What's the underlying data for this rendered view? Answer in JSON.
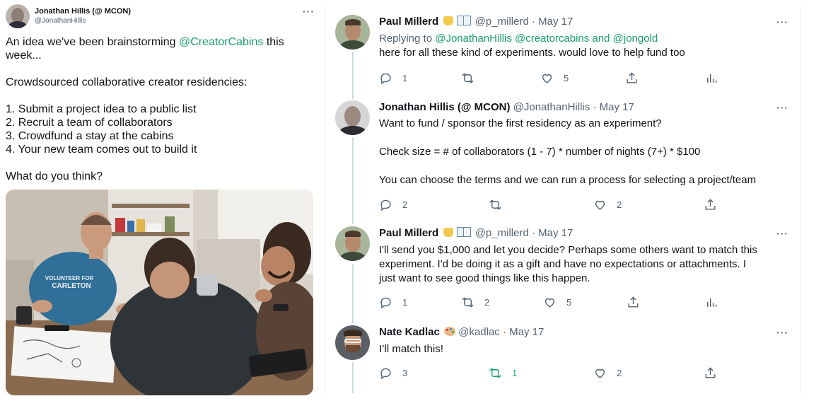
{
  "left_tweet": {
    "author_name": "Jonathan Hillis (@ MCON)",
    "author_handle": "@JonathanHillis",
    "more": "···",
    "text_line1_before": "An idea we've been brainstorming ",
    "text_line1_mention": "@CreatorCabins",
    "text_line1_after": " this",
    "text_line2": "week...",
    "text_line3": "Crowdsourced collaborative creator residencies:",
    "steps": [
      "1. Submit a project idea to a public list",
      "2. Recruit a team of collaborators",
      "3. Crowdfund a stay at the cabins",
      "4. Your new team comes out to build it"
    ],
    "closing": "What do you think?",
    "shirt_text_1": "VOLUNTEER FOR",
    "shirt_text_2": "CARLETON"
  },
  "replies": [
    {
      "name": "Paul Millerd",
      "handle": "@p_millerd",
      "date": "May 17",
      "replying_prefix": "Replying to ",
      "replying_mentions": "@JonathanHillis @creatorcabins and @jongold",
      "body": [
        "here for all these kind of experiments.  would love to help fund too"
      ],
      "reply_count": "1",
      "retweet_count": "",
      "like_count": "5",
      "more": "···"
    },
    {
      "name": "Jonathan Hillis (@ MCON)",
      "handle": "@JonathanHillis",
      "date": "May 17",
      "body": [
        "Want to fund / sponsor the first residency as an experiment?",
        "Check size = # of collaborators (1 - 7) * number of nights (7+) * $100",
        "You can choose the terms and we can run a process for selecting a project/team"
      ],
      "reply_count": "2",
      "retweet_count": "",
      "like_count": "2",
      "more": "···"
    },
    {
      "name": "Paul Millerd",
      "handle": "@p_millerd",
      "date": "May 17",
      "body": [
        "I'll send you $1,000 and let you decide?  Perhaps some others want to match this",
        "experiment.  I'd be doing it as a gift and have no expectations or attachments.  I",
        "just want to see good things like this happen."
      ],
      "reply_count": "1",
      "retweet_count": "2",
      "like_count": "5",
      "more": "···"
    },
    {
      "name": "Nate Kadlac",
      "handle": "@kadlac",
      "date": "May 17",
      "body": [
        "I’ll match this!"
      ],
      "reply_count": "3",
      "retweet_count": "1",
      "like_count": "2",
      "more": "···"
    }
  ],
  "colors": {
    "link": "#1b9e6f",
    "retweeted": "#17a365",
    "meta": "#536471",
    "text": "#0f1419"
  }
}
